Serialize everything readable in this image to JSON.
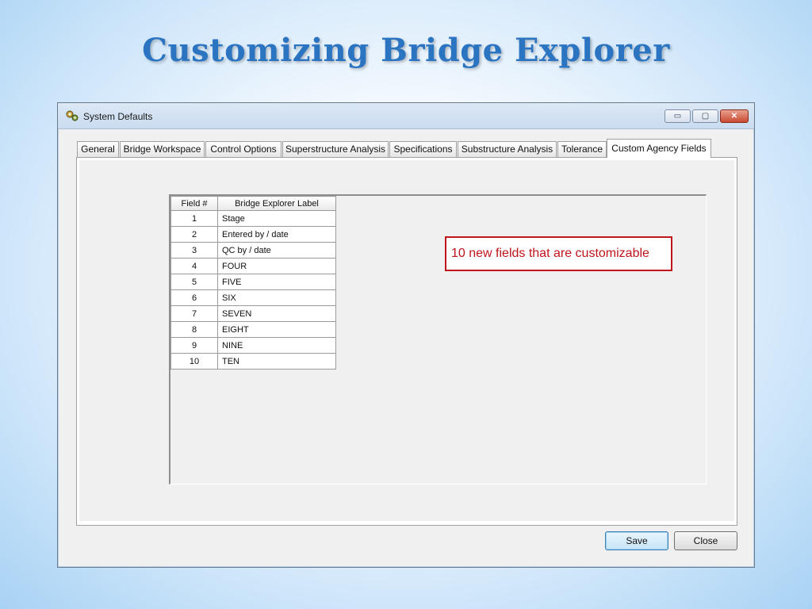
{
  "slide": {
    "title": "Customizing Bridge Explorer"
  },
  "window": {
    "title": "System Defaults",
    "controls": {
      "minimize": "▭",
      "maximize": "▢",
      "close": "✕"
    }
  },
  "tabs": [
    "General",
    "Bridge Workspace",
    "Control Options",
    "Superstructure Analysis",
    "Specifications",
    "Substructure Analysis",
    "Tolerance",
    "Custom Agency Fields"
  ],
  "active_tab": "Custom Agency Fields",
  "table": {
    "headers": [
      "Field #",
      "Bridge Explorer Label"
    ],
    "rows": [
      [
        "1",
        "Stage"
      ],
      [
        "2",
        "Entered by / date"
      ],
      [
        "3",
        "QC by / date"
      ],
      [
        "4",
        "FOUR"
      ],
      [
        "5",
        "FIVE"
      ],
      [
        "6",
        "SIX"
      ],
      [
        "7",
        "SEVEN"
      ],
      [
        "8",
        "EIGHT"
      ],
      [
        "9",
        "NINE"
      ],
      [
        "10",
        "TEN"
      ]
    ]
  },
  "callout": {
    "text": "10 new fields that are customizable",
    "color": "#c0141c"
  },
  "buttons": {
    "save": "Save",
    "close": "Close"
  },
  "colors": {
    "title": "#2b74c2"
  }
}
